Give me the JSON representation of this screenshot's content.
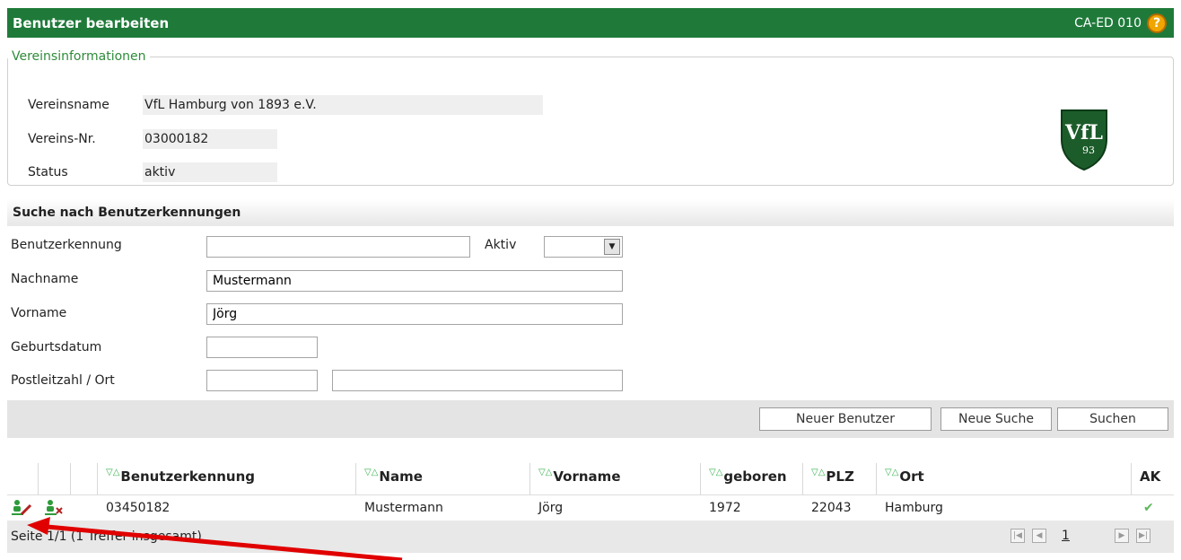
{
  "header": {
    "title": "Benutzer bearbeiten",
    "code": "CA-ED 010",
    "help_icon": "question-icon"
  },
  "vereinsinfo": {
    "legend": "Vereinsinformationen",
    "rows": [
      {
        "label": "Vereinsname",
        "value": "VfL Hamburg von 1893 e.V."
      },
      {
        "label": "Vereins-Nr.",
        "value": "03000182"
      },
      {
        "label": "Status",
        "value": "aktiv"
      }
    ],
    "logo_text": "VfL",
    "logo_sub": "93"
  },
  "search": {
    "title": "Suche nach Benutzerkennungen",
    "fields": {
      "benutzerkennung": {
        "label": "Benutzerkennung",
        "value": ""
      },
      "aktiv": {
        "label": "Aktiv",
        "value": ""
      },
      "nachname": {
        "label": "Nachname",
        "value": "Mustermann"
      },
      "vorname": {
        "label": "Vorname",
        "value": "Jörg"
      },
      "geburtsdatum": {
        "label": "Geburtsdatum",
        "value": ""
      },
      "plz_ort": {
        "label": "Postleitzahl / Ort",
        "plz": "",
        "ort": ""
      }
    },
    "buttons": {
      "neuer_benutzer": "Neuer Benutzer",
      "neue_suche": "Neue Suche",
      "suchen": "Suchen"
    }
  },
  "results": {
    "sort_icon": "▽△",
    "columns": [
      "Benutzerkennung",
      "Name",
      "Vorname",
      "geboren",
      "PLZ",
      "Ort",
      "AK"
    ],
    "rows": [
      {
        "benutzerkennung": "03450182",
        "name": "Mustermann",
        "vorname": "Jörg",
        "geboren": "1972",
        "plz": "22043",
        "ort": "Hamburg",
        "ak": "✔"
      }
    ],
    "pager_text": "Seite 1/1 (1 Treffer insgesamt)",
    "page_number": "1"
  },
  "colors": {
    "header_green": "#1f7a3a",
    "legend_green": "#2e8b3a",
    "annotation_red": "#e00000"
  }
}
